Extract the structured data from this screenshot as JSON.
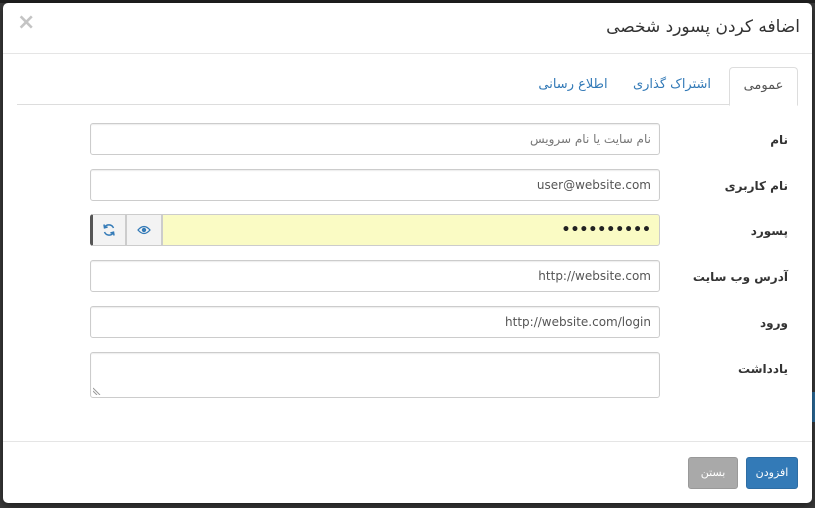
{
  "modal": {
    "title": "اضافه کردن پسورد شخصی",
    "close_symbol": "×"
  },
  "tabs": [
    {
      "label": "عمومی",
      "active": true
    },
    {
      "label": "اشتراک گذاری",
      "active": false
    },
    {
      "label": "اطلاع رسانی",
      "active": false
    }
  ],
  "form": {
    "name": {
      "label": "نام",
      "value": "",
      "placeholder": "نام سایت یا نام سرویس"
    },
    "username": {
      "label": "نام کاربری",
      "value": "user@website.com"
    },
    "password": {
      "label": "پسورد",
      "value": "••••••••••",
      "toggle_icon": "eye-icon",
      "generate_icon": "refresh-icon"
    },
    "website": {
      "label": "آدرس وب سایت",
      "value": "http://website.com"
    },
    "login": {
      "label": "ورود",
      "value": "http://website.com/login"
    },
    "note": {
      "label": "یادداشت",
      "value": ""
    }
  },
  "footer": {
    "add_label": "افزودن",
    "close_label": "بستن"
  },
  "colors": {
    "primary": "#337ab7",
    "password_bg": "#fafbc4",
    "close_button": "#a9a9a9"
  }
}
